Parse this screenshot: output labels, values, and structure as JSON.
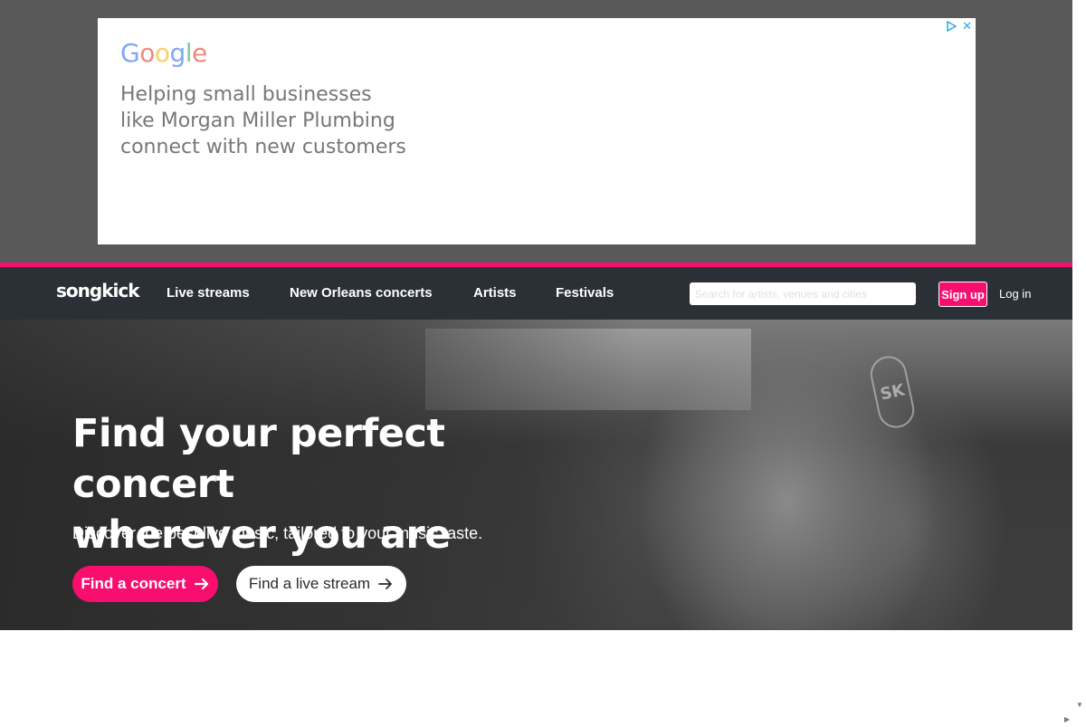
{
  "ad": {
    "logo_letters": [
      "G",
      "o",
      "o",
      "g",
      "l",
      "e"
    ],
    "headline_lines": [
      "Helping small businesses",
      "like Morgan Miller Plumbing",
      "connect with new customers"
    ],
    "controls": {
      "choices_icon": "ad-choices-icon",
      "close_icon": "close-icon",
      "close_glyph": "✕"
    }
  },
  "nav": {
    "logo": "songkick",
    "links": [
      "Live streams",
      "New Orleans concerts",
      "Artists",
      "Festivals"
    ],
    "search_placeholder": "Search for artists, venues and cities",
    "signup_label": "Sign up",
    "login_label": "Log in"
  },
  "hero": {
    "title_line1": "Find your perfect concert",
    "title_line2": "wherever you are",
    "subtitle": "Discover the best live music, tailored to your music taste.",
    "primary_cta": "Find a concert",
    "secondary_cta": "Find a live stream",
    "venue_badge": "SK"
  },
  "colors": {
    "brand_pink": "#f80e6f",
    "nav_bg": "#2b3037",
    "ad_bg": "#595959"
  },
  "icons": [
    "ad-choices-icon",
    "close-icon",
    "arrow-right-icon"
  ]
}
